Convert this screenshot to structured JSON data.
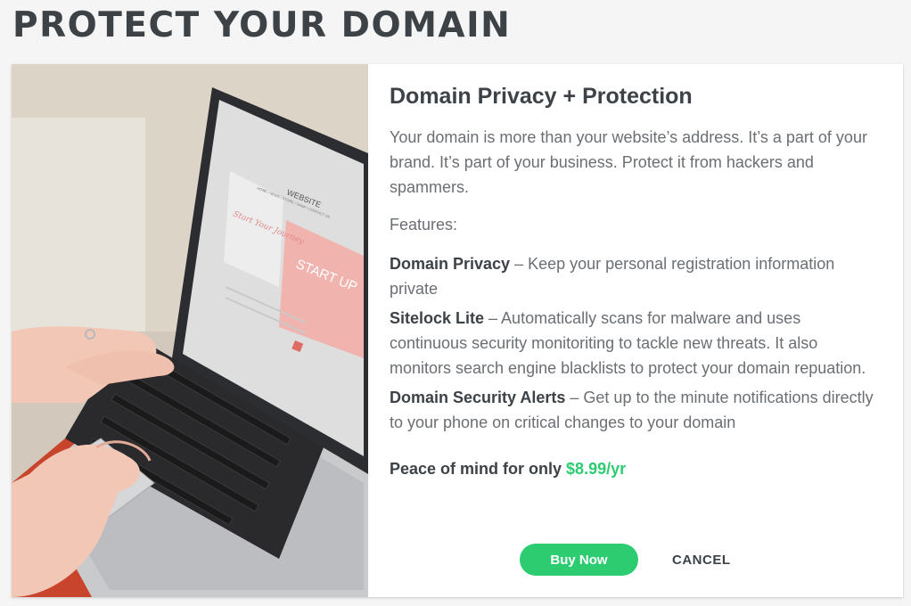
{
  "page": {
    "title": "PROTECT YOUR DOMAIN"
  },
  "product": {
    "title": "Domain Privacy + Protection",
    "description": "Your domain is more than your website’s address. It’s a part of your brand. It’s part of your business. Protect it from hackers and spammers.",
    "features_label": "Features:",
    "features": [
      {
        "name": "Domain Privacy",
        "text": " – Keep your personal registration information private"
      },
      {
        "name": "Sitelock Lite",
        "text": " – Automatically scans for malware and uses continuous security monitoriting to tackle new threats. It also monitors search engine blacklists to protect your domain repuation."
      },
      {
        "name": "Domain Security Alerts",
        "text": " – Get up to the minute notifications directly to your phone on critical changes to your domain"
      }
    ],
    "price_label": "Peace of mind for only ",
    "price": "$8.99/yr"
  },
  "image": {
    "screen_site_title": "WEBSITE",
    "screen_nav": "HOME / NEWS / STORE / SHOP / CONTACT US",
    "screen_script": "Start Your Journey",
    "screen_banner": "START UP"
  },
  "actions": {
    "buy_label": "Buy Now",
    "cancel_label": "CANCEL"
  },
  "colors": {
    "accent": "#2ecc71",
    "heading": "#3d4247",
    "body_text": "#6a6f74",
    "sofa_red": "#c8442c"
  }
}
